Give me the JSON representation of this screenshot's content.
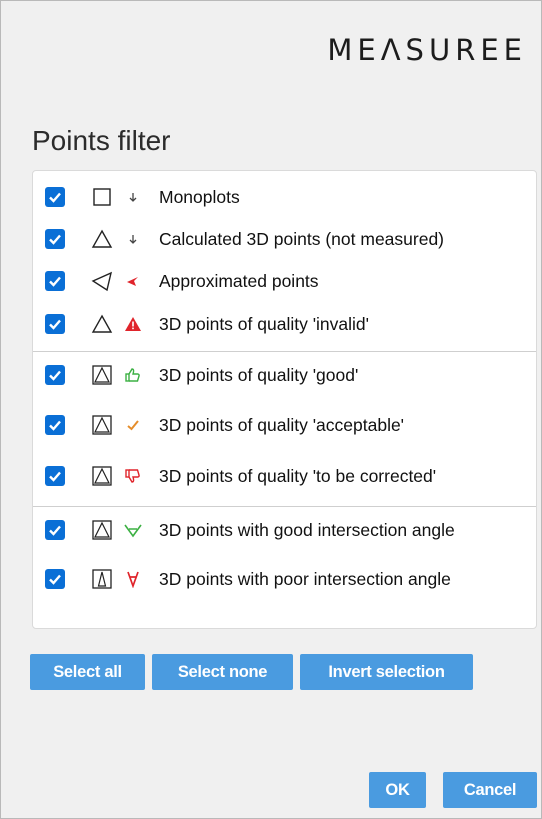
{
  "logo": "MEΛSUREE",
  "title": "Points filter",
  "items": [
    {
      "label": "Monoplots",
      "checked": true,
      "symbol": "square-icon",
      "marker": "small-arrow-down-icon"
    },
    {
      "label": "Calculated 3D points (not measured)",
      "checked": true,
      "symbol": "triangle-outline-icon",
      "marker": "small-arrow-down-icon"
    },
    {
      "label": "Approximated points",
      "checked": true,
      "symbol": "left-triangle-outline-icon",
      "marker": "red-pointer-icon"
    },
    {
      "label": "3D points of quality 'invalid'",
      "checked": true,
      "symbol": "triangle-outline-icon",
      "marker": "red-warning-icon"
    },
    {
      "label": "3D points of quality 'good'",
      "checked": true,
      "symbol": "framed-triangle-icon",
      "marker": "green-thumbs-up-icon"
    },
    {
      "label": "3D points of quality 'acceptable'",
      "checked": true,
      "symbol": "framed-triangle-icon",
      "marker": "orange-check-icon"
    },
    {
      "label": "3D points of quality 'to be corrected'",
      "checked": true,
      "symbol": "framed-triangle-icon",
      "marker": "red-thumbs-down-icon"
    },
    {
      "label": "3D points with good intersection angle",
      "checked": true,
      "symbol": "framed-triangle-icon",
      "marker": "green-wide-v-icon"
    },
    {
      "label": "3D points with poor intersection angle",
      "checked": true,
      "symbol": "framed-narrow-triangle-icon",
      "marker": "red-narrow-v-icon"
    }
  ],
  "buttons": {
    "select_all": "Select all",
    "select_none": "Select none",
    "invert_selection": "Invert selection",
    "ok": "OK",
    "cancel": "Cancel"
  },
  "colors": {
    "checkbox": "#0a6fd6",
    "button": "#4a9be0",
    "red": "#e0242b",
    "green": "#3cb043",
    "orange": "#e58d2b"
  }
}
